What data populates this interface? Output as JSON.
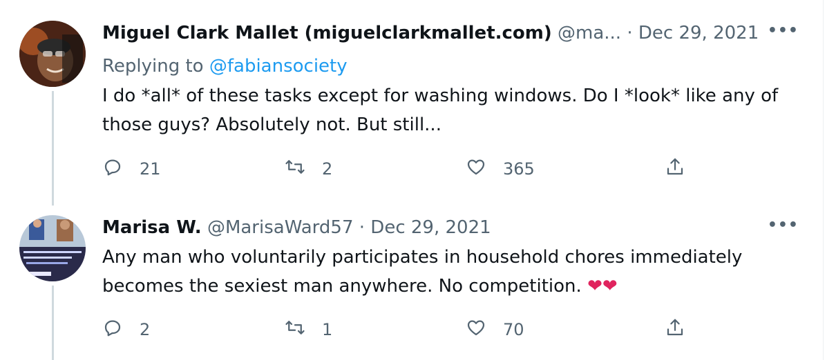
{
  "tweets": [
    {
      "name": "Miguel Clark Mallet (miguelclarkmallet.com)",
      "handle": "@ma...",
      "dot": "·",
      "date": "Dec 29, 2021",
      "more": "•••",
      "replying_prefix": "Replying to ",
      "replying_to": "@fabiansociety",
      "body": "I do *all* of these tasks except for washing windows. Do I *look* like any of those guys? Absolutely not. But still...",
      "replies": "21",
      "retweets": "2",
      "likes": "365"
    },
    {
      "name": "Marisa W.",
      "handle": "@MarisaWard57",
      "dot": "·",
      "date": "Dec 29, 2021",
      "more": "•••",
      "body": "Any man who voluntarily participates in household chores immediately becomes the sexiest man anywhere. No competition.",
      "emoji": "❤❤",
      "replies": "2",
      "retweets": "1",
      "likes": "70"
    }
  ],
  "icons": {
    "reply": "reply-icon",
    "retweet": "retweet-icon",
    "like": "heart-icon",
    "share": "share-icon"
  },
  "colors": {
    "text": "#0f1419",
    "secondary": "#536471",
    "link": "#1d9bf0",
    "thread_line": "#cfd9de",
    "heart": "#e0245e"
  }
}
